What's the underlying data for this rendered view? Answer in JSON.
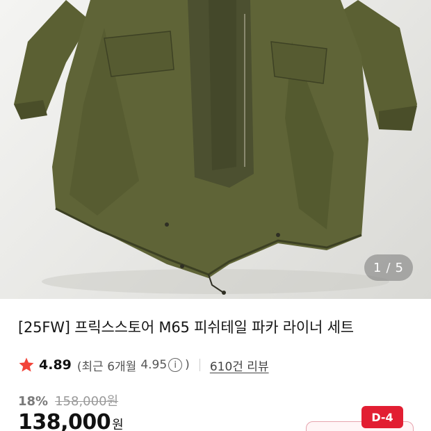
{
  "product_image": {
    "alt": "",
    "counter": {
      "current": "1",
      "separator": "/",
      "total": "5"
    }
  },
  "product": {
    "title": "[25FW] 프릭스스토어 M65 피쉬테일 파카 라이너 세트",
    "rating": "4.89",
    "recent_open": "(최근 6개월",
    "recent_value": "4.95",
    "recent_close": ")",
    "review_count": "610건 리뷰",
    "discount": "18%",
    "original_price": "158,000원",
    "price": "138,000",
    "price_unit": "원",
    "dday_badge": "D-4"
  },
  "colors": {
    "star": "#f2443a",
    "badge": "#e21e32",
    "jacket": "#55592f"
  }
}
